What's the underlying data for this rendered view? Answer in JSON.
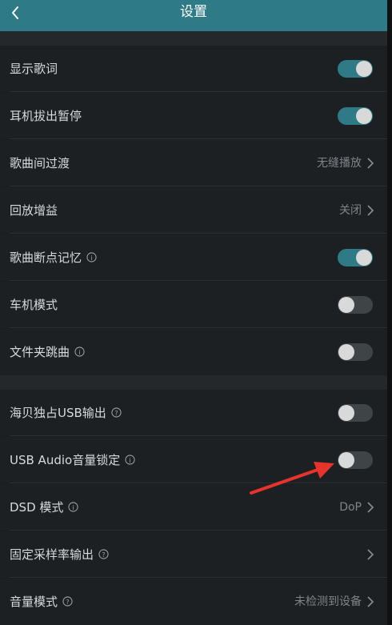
{
  "header": {
    "title": "设置"
  },
  "rows": [
    {
      "label": "显示歌词",
      "info": false,
      "control": "toggle",
      "state": "on"
    },
    {
      "label": "耳机拔出暂停",
      "info": false,
      "control": "toggle",
      "state": "on"
    },
    {
      "label": "歌曲间过渡",
      "info": false,
      "control": "value",
      "value": "无缝播放"
    },
    {
      "label": "回放增益",
      "info": false,
      "control": "value",
      "value": "关闭"
    },
    {
      "label": "歌曲断点记忆",
      "info": "i",
      "control": "toggle",
      "state": "on"
    },
    {
      "label": "车机模式",
      "info": false,
      "control": "toggle",
      "state": "off"
    },
    {
      "label": "文件夹跳曲",
      "info": "i",
      "control": "toggle",
      "state": "off"
    },
    {
      "label": "海贝独占USB输出",
      "info": "?",
      "control": "toggle",
      "state": "off"
    },
    {
      "label": "USB Audio音量锁定",
      "info": "i",
      "control": "toggle",
      "state": "off"
    },
    {
      "label": "DSD 模式",
      "info": "i",
      "control": "value",
      "value": "DoP"
    },
    {
      "label": "固定采样率输出",
      "info": "?",
      "control": "value",
      "value": ""
    },
    {
      "label": "音量模式",
      "info": "?",
      "control": "value",
      "value": "未检测到设备"
    }
  ],
  "colors": {
    "header": "#2e7a86",
    "toggle_on": "#2e7a86",
    "toggle_off": "#3f4447",
    "annotation_arrow": "#e8322c"
  },
  "icons": {
    "back": "chevron-left-icon",
    "info": "info-icon",
    "help": "question-icon",
    "chevron": "chevron-right-icon"
  }
}
